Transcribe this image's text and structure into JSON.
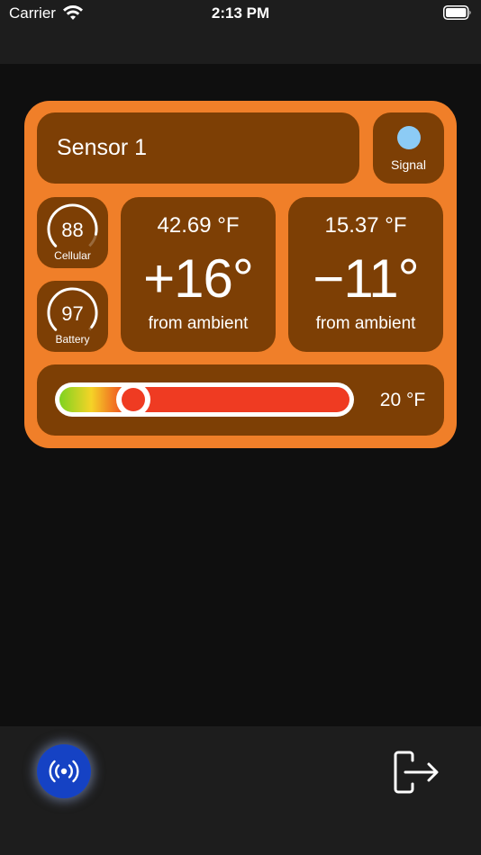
{
  "status_bar": {
    "carrier": "Carrier",
    "time": "2:13 PM",
    "wifi_icon": "wifi-icon",
    "battery_icon": "battery-full-icon"
  },
  "sensor": {
    "name": "Sensor 1",
    "signal": {
      "label": "Signal",
      "color": "#8ccbf5"
    },
    "cellular": {
      "value": "88",
      "label": "Cellular",
      "level": 0.88
    },
    "battery": {
      "value": "97",
      "label": "Battery",
      "level": 0.97
    },
    "temperature_left": {
      "reading": "42.69 °F",
      "delta": "+16°",
      "caption": "from ambient"
    },
    "temperature_right": {
      "reading": "15.37 °F",
      "delta": "−11°",
      "caption": "from ambient"
    },
    "threshold": {
      "value_label": "20 °F",
      "position": 0.23
    }
  },
  "colors": {
    "card": "#f07f29",
    "tile": "#7d3f05",
    "bar_background": "#1d1d1d",
    "screen_background": "#0f0f0f",
    "slider_red": "#ef3b22",
    "broadcast_blue": "#1542c4"
  },
  "toolbar": {
    "broadcast_icon": "broadcast-icon",
    "logout_icon": "logout-icon"
  }
}
